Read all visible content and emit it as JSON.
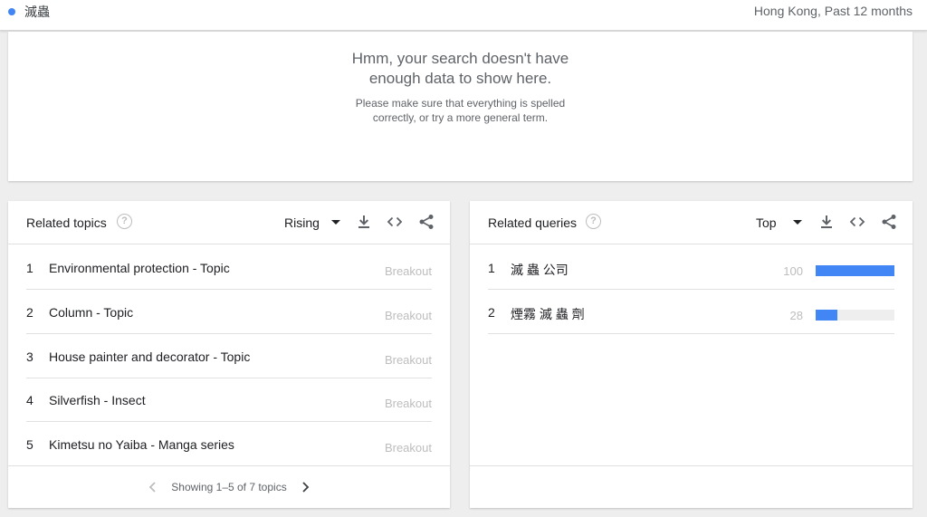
{
  "header": {
    "term": "滅蟲",
    "meta": "Hong Kong, Past 12 months",
    "term_color": "#4285f4"
  },
  "no_data": {
    "headline": "Hmm, your search doesn't have enough data to show here.",
    "sub": "Please make sure that everything is spelled correctly, or try a more general term."
  },
  "related_topics": {
    "title": "Related topics",
    "help": "?",
    "selector": "Rising",
    "rows": [
      {
        "num": "1",
        "label": "Environmental protection - Topic",
        "value": "Breakout"
      },
      {
        "num": "2",
        "label": "Column - Topic",
        "value": "Breakout"
      },
      {
        "num": "3",
        "label": "House painter and decorator - Topic",
        "value": "Breakout"
      },
      {
        "num": "4",
        "label": "Silverfish - Insect",
        "value": "Breakout"
      },
      {
        "num": "5",
        "label": "Kimetsu no Yaiba - Manga series",
        "value": "Breakout"
      }
    ],
    "pager": "Showing 1–5 of 7 topics",
    "icons": [
      "download-icon",
      "embed-code-icon",
      "share-icon",
      "chevron-left-icon",
      "chevron-right-icon"
    ]
  },
  "related_queries": {
    "title": "Related queries",
    "help": "?",
    "selector": "Top",
    "rows": [
      {
        "num": "1",
        "label": "滅 蟲 公司",
        "value": "100",
        "bar_percent": 100
      },
      {
        "num": "2",
        "label": "煙霧 滅 蟲 劑",
        "value": "28",
        "bar_percent": 28
      }
    ],
    "bar_color": "#4285f4",
    "icons": [
      "download-icon",
      "embed-code-icon",
      "share-icon"
    ]
  }
}
